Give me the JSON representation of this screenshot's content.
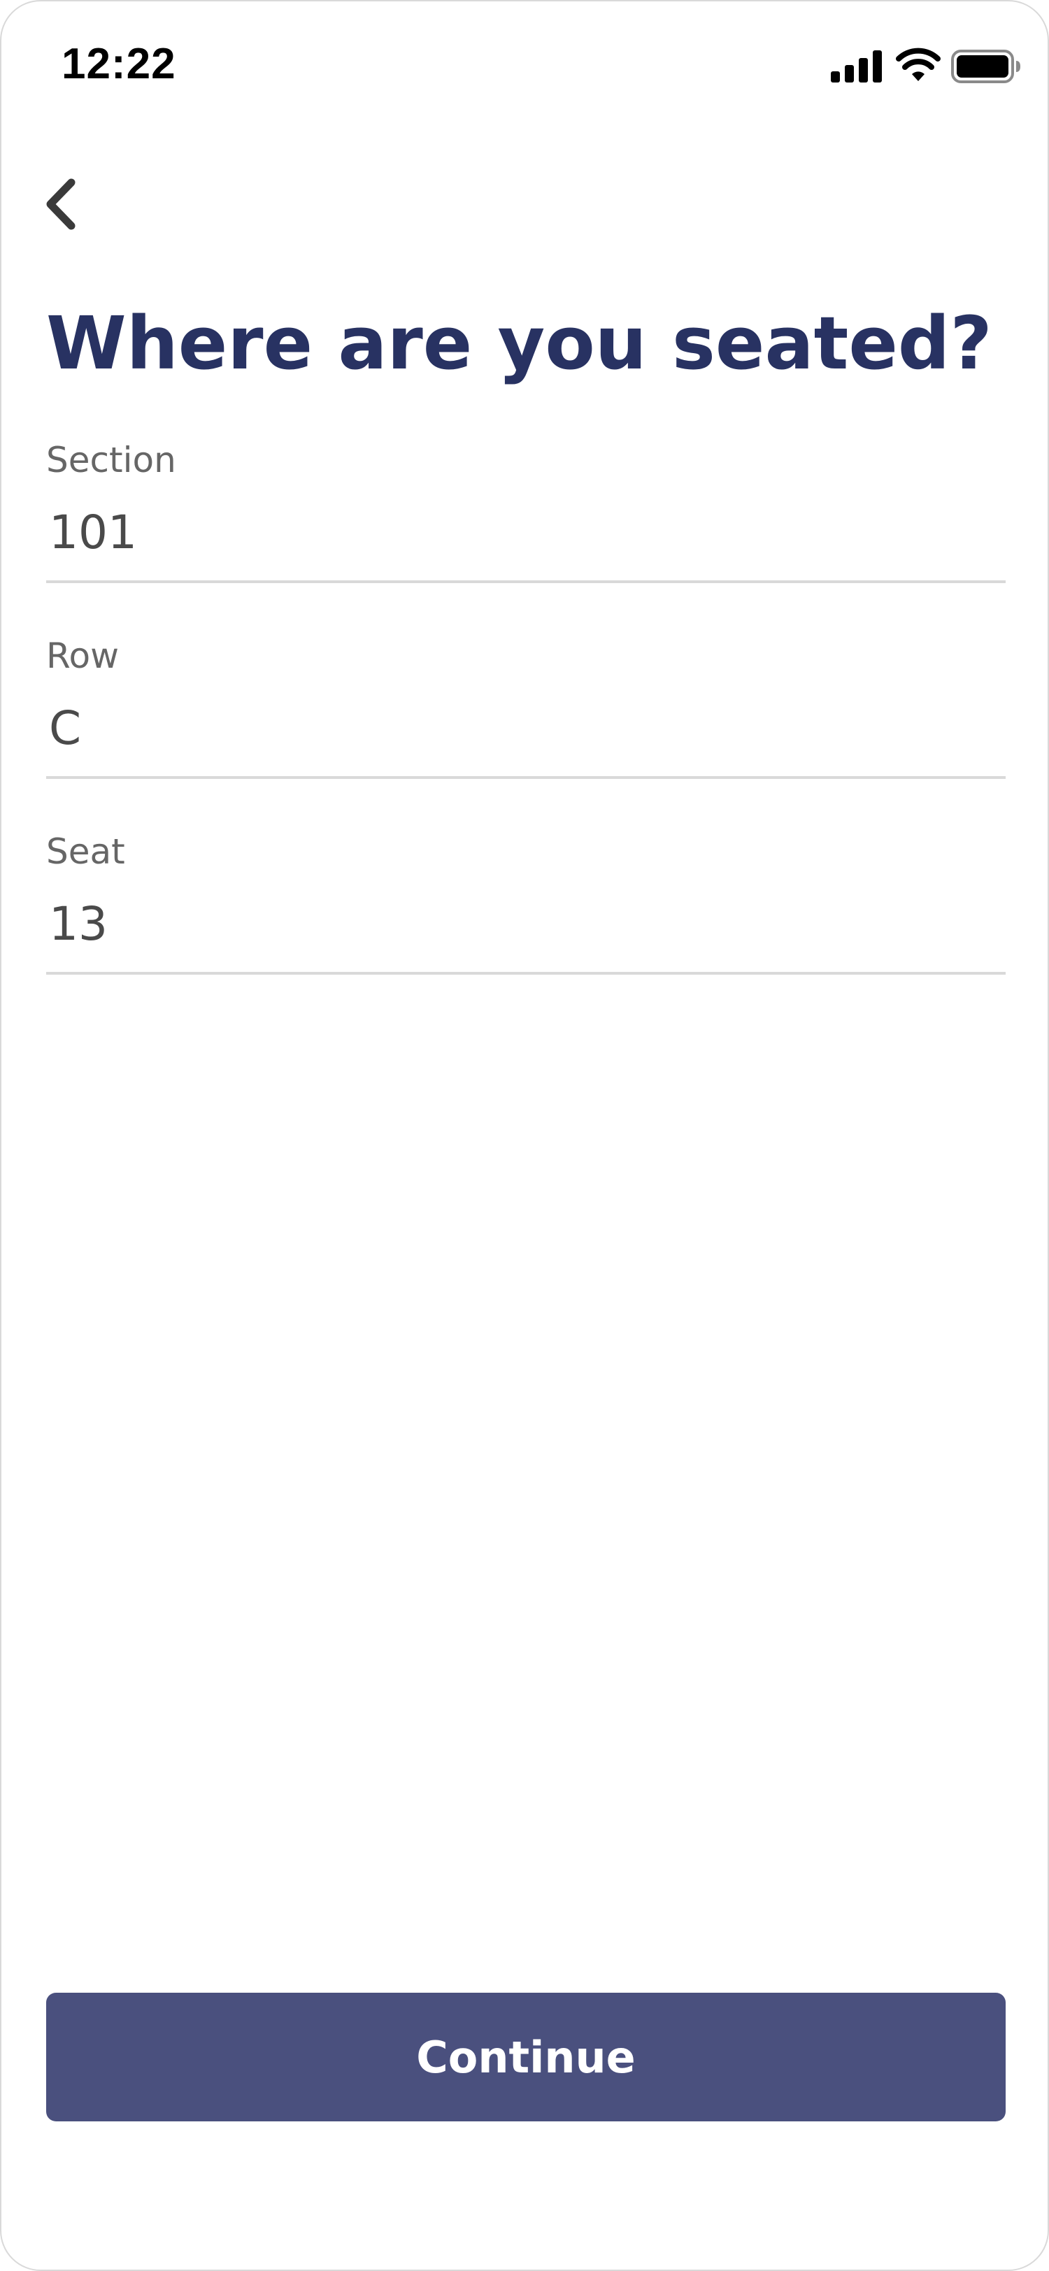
{
  "status_bar": {
    "time": "12:22",
    "icons": [
      "cellular-signal-icon",
      "wifi-icon",
      "battery-icon"
    ]
  },
  "header": {
    "back_icon": "chevron-left-icon"
  },
  "page": {
    "title": "Where are you seated?"
  },
  "form": {
    "fields": [
      {
        "label": "Section",
        "value": "101"
      },
      {
        "label": "Row",
        "value": "C"
      },
      {
        "label": "Seat",
        "value": "13"
      }
    ]
  },
  "actions": {
    "continue_label": "Continue"
  },
  "colors": {
    "title": "#283262",
    "button_background": "#4a507e",
    "button_text": "#ffffff",
    "label": "#666666",
    "value": "#4a4a4a",
    "divider": "#d9d9d9"
  }
}
